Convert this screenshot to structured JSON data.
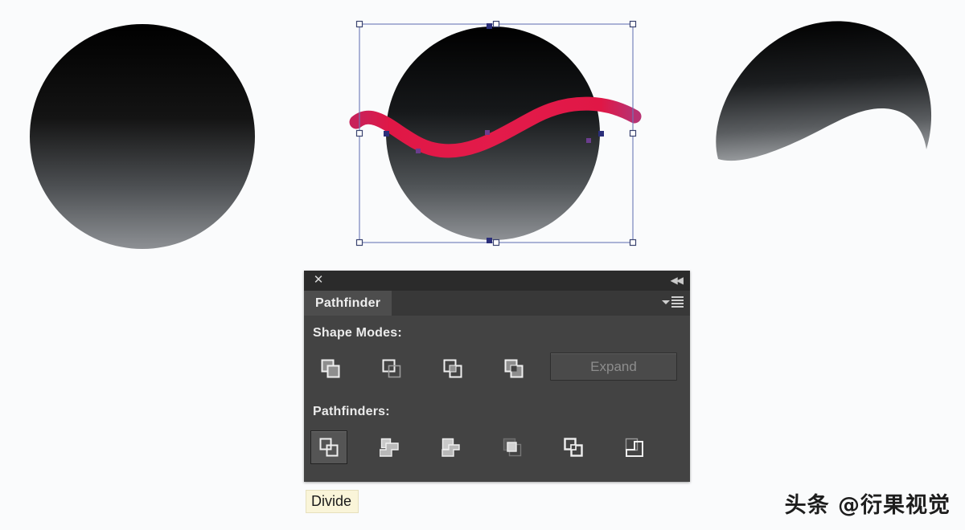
{
  "canvas": {
    "background_color": "#fafbfc",
    "shapes": [
      {
        "name": "circle-original",
        "label": "Original gradient circle",
        "type": "circle",
        "fill": "linear-gradient black to gray",
        "gradient_start": "#000000",
        "gradient_end": "#8d9094"
      },
      {
        "name": "circle-selected",
        "label": "Selected circle with wave path",
        "type": "circle",
        "selected": true,
        "gradient_start": "#000000",
        "gradient_end": "#8d9094"
      },
      {
        "name": "wave-path",
        "label": "Red S-curve wave stroke",
        "type": "path",
        "stroke_color": "#e01746",
        "stroke_width": 17
      },
      {
        "name": "crescent-result",
        "label": "Divided crescent result",
        "type": "path",
        "gradient_start": "#000000",
        "gradient_end": "#8d9094"
      }
    ],
    "selection": {
      "bbox_stroke": "#6b78b8",
      "handle_fill": "#ffffff",
      "handle_stroke": "#3b4470",
      "anchor_fill": "#2b2f7a"
    }
  },
  "panel": {
    "title": "Pathfinder",
    "close_label": "✕",
    "collapse_label": "◀◀",
    "menu_icon": "panel-menu-icon",
    "shape_modes": {
      "label": "Shape Modes:",
      "buttons": [
        {
          "name": "unite",
          "label": "Unite"
        },
        {
          "name": "minus-front",
          "label": "Minus Front"
        },
        {
          "name": "intersect",
          "label": "Intersect"
        },
        {
          "name": "exclude",
          "label": "Exclude"
        }
      ],
      "expand_label": "Expand",
      "expand_enabled": false
    },
    "pathfinders": {
      "label": "Pathfinders:",
      "buttons": [
        {
          "name": "divide",
          "label": "Divide",
          "selected": true
        },
        {
          "name": "trim",
          "label": "Trim",
          "selected": false
        },
        {
          "name": "merge",
          "label": "Merge",
          "selected": false
        },
        {
          "name": "crop",
          "label": "Crop",
          "selected": false
        },
        {
          "name": "outline",
          "label": "Outline",
          "selected": false
        },
        {
          "name": "minus-back",
          "label": "Minus Back",
          "selected": false
        }
      ]
    }
  },
  "tooltip": {
    "text": "Divide",
    "background_color": "#faf5d9"
  },
  "watermark": {
    "text": "头条 @衍果视觉"
  }
}
